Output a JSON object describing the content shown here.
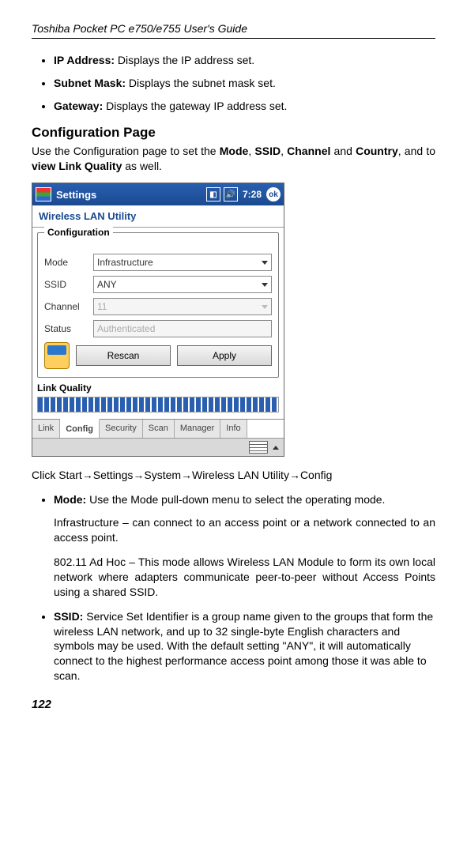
{
  "header": "Toshiba Pocket PC e750/e755  User's Guide",
  "bullets_top": [
    {
      "term": "IP Address:",
      "text": " Displays the IP address set."
    },
    {
      "term": "Subnet Mask:",
      "text": " Displays the subnet mask set."
    },
    {
      "term": "Gateway:",
      "text": " Displays the gateway IP address set."
    }
  ],
  "section_title": "Configuration Page",
  "section_intro_a": "Use the Configuration page to set the ",
  "section_intro_b": ", ",
  "section_intro_c": ", ",
  "section_intro_d": " and ",
  "section_intro_e": ", and to ",
  "section_intro_f": " as well.",
  "bold_mode": "Mode",
  "bold_ssid": "SSID",
  "bold_channel": "Channel",
  "bold_country": "Country",
  "bold_vlq": "view Link Quality",
  "shot": {
    "title": "Settings",
    "time": "7:28",
    "ok": "ok",
    "util_title": "Wireless LAN Utility",
    "group_legend": "Configuration",
    "rows": {
      "mode": {
        "label": "Mode",
        "value": "Infrastructure"
      },
      "ssid": {
        "label": "SSID",
        "value": "ANY"
      },
      "channel": {
        "label": "Channel",
        "value": "11"
      },
      "status": {
        "label": "Status",
        "value": "Authenticated"
      }
    },
    "buttons": {
      "rescan": "Rescan",
      "apply": "Apply"
    },
    "lq_label": "Link Quality",
    "tabs": [
      "Link",
      "Config",
      "Security",
      "Scan",
      "Manager",
      "Info"
    ]
  },
  "nav_path": "Click Start→Settings→System→Wireless LAN Utility→Config",
  "bullets_bottom": [
    {
      "term": "Mode:",
      "text": " Use the Mode pull-down menu to select the operating mode.",
      "paras": [
        "Infrastructure – can connect to an access point or a network connected to an access point.",
        "802.11 Ad Hoc – This mode allows Wireless LAN Module to form its own local network where adapters communicate peer-to-peer without Access Points using a shared SSID."
      ]
    },
    {
      "term": "SSID:",
      "text": " Service Set  Identifier is a group name given to the groups that form the wireless LAN network, and up to 32 single-byte English characters and symbols may be used. With the default setting \"ANY\", it will automatically connect to the highest performance access point among those it was able to scan.",
      "paras": []
    }
  ],
  "page_number": "122"
}
